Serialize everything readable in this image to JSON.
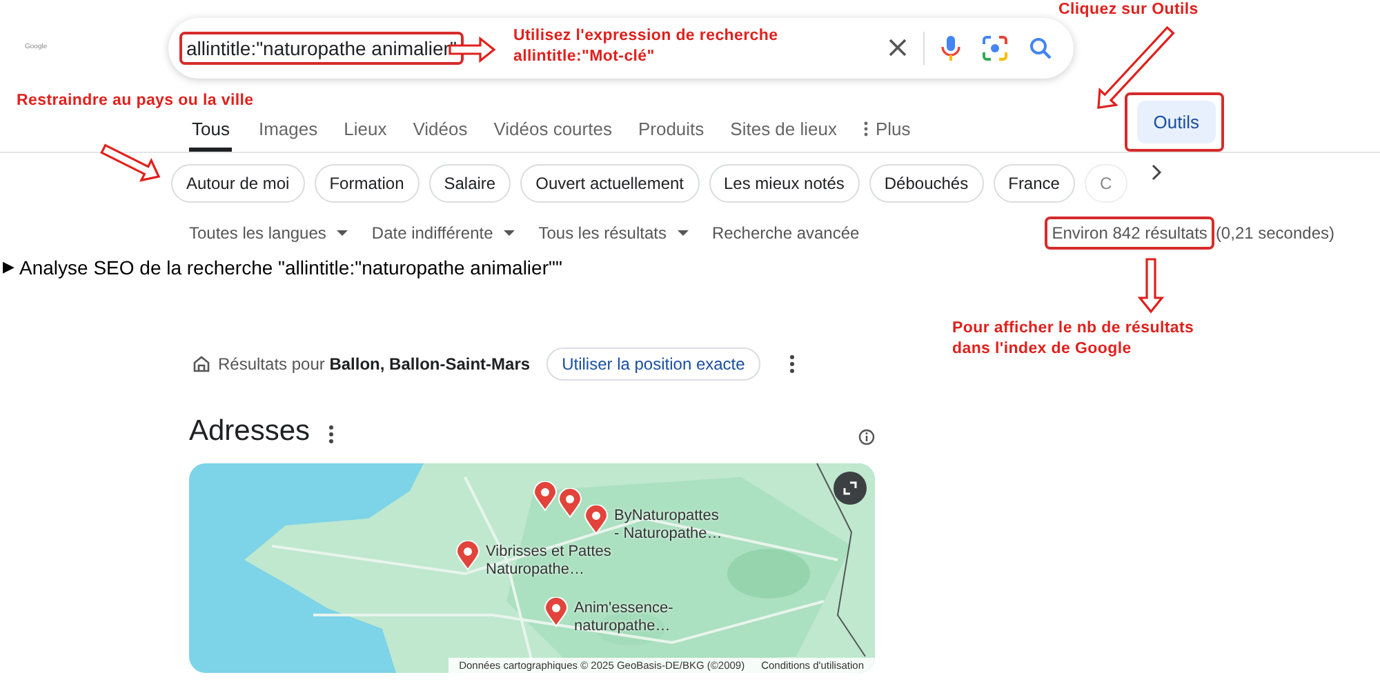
{
  "logo": "Google",
  "search": {
    "value": "allintitle:\"naturopathe animalier\""
  },
  "tabs": [
    {
      "label": "Tous",
      "selected": true
    },
    {
      "label": "Images",
      "selected": false
    },
    {
      "label": "Lieux",
      "selected": false
    },
    {
      "label": "Vidéos",
      "selected": false
    },
    {
      "label": "Vidéos courtes",
      "selected": false
    },
    {
      "label": "Produits",
      "selected": false
    },
    {
      "label": "Sites de lieux",
      "selected": false
    },
    {
      "label": "Plus",
      "selected": false,
      "kind": "more"
    }
  ],
  "tools_button": "Outils",
  "chips": [
    {
      "label": "Autour de moi",
      "faded": false
    },
    {
      "label": "Formation",
      "faded": false
    },
    {
      "label": "Salaire",
      "faded": false
    },
    {
      "label": "Ouvert actuellement",
      "faded": false
    },
    {
      "label": "Les mieux notés",
      "faded": false
    },
    {
      "label": "Débouchés",
      "faded": false
    },
    {
      "label": "France",
      "faded": false
    },
    {
      "label": "C",
      "faded": true
    }
  ],
  "filters": [
    {
      "label": "Toutes les langues",
      "kind": "dropdown"
    },
    {
      "label": "Date indifférente",
      "kind": "dropdown"
    },
    {
      "label": "Tous les résultats",
      "kind": "dropdown"
    },
    {
      "label": "Recherche avancée",
      "kind": "link"
    }
  ],
  "result_count": "Environ 842 résultats",
  "result_time": "(0,21 secondes)",
  "seo_summary": {
    "marker": "▶",
    "text": "Analyse SEO de la recherche \"allintitle:\"naturopathe animalier\"\""
  },
  "location": {
    "text": "Résultats pour **Ballon, Ballon-Saint-Mars**",
    "button": "Utiliser la position exacte"
  },
  "places": {
    "title": "Adresses",
    "pins": [
      {
        "kind": "pin"
      },
      {
        "kind": "pin"
      },
      {
        "kind": "pin",
        "label": "ByNaturopattes\n- Naturopathe…"
      },
      {
        "kind": "pin",
        "label": "Vibrisses et Pattes\nNaturopathe…"
      },
      {
        "kind": "pin",
        "label": "Anim'essence-\nnaturopathe…"
      }
    ],
    "attribution": "Données cartographiques © 2025 GeoBasis-DE/BKG (©2009)",
    "terms": "Conditions d'utilisation"
  },
  "annotations": [
    {
      "kind": "query",
      "text": "Utilisez l'expression de recherche\nallintitle:\"Mot-clé\""
    },
    {
      "kind": "tools",
      "text": "Cliquez sur Outils"
    },
    {
      "kind": "chips",
      "text": "Restraindre au pays ou la ville"
    },
    {
      "kind": "count",
      "text": "Pour afficher le nb de résultats\ndans l'index de Google"
    }
  ]
}
